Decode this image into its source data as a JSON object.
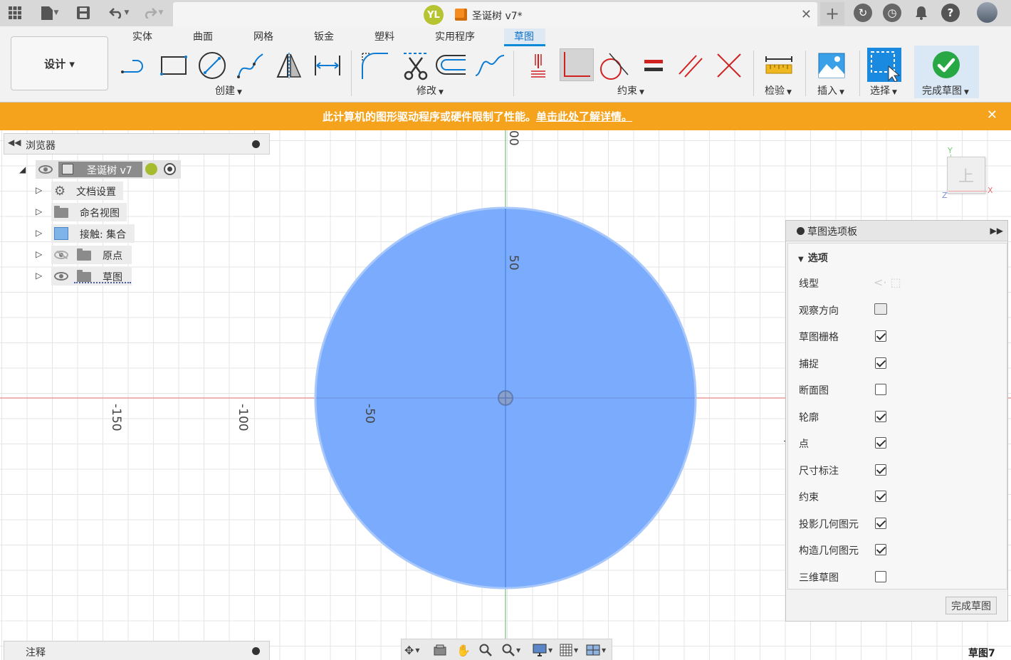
{
  "document": {
    "title": "圣诞树 v7*",
    "user_initials": "YL"
  },
  "ribbon": {
    "tabs": [
      "实体",
      "曲面",
      "网格",
      "钣金",
      "塑料",
      "实用程序",
      "草图"
    ],
    "active_tab": "草图",
    "design_button": "设计 ▾",
    "groups": {
      "create": "创建",
      "modify": "修改",
      "constrain": "约束",
      "inspect": "检验",
      "insert": "插入",
      "select": "选择",
      "finish": "完成草图"
    }
  },
  "warning": {
    "text": "此计算机的图形驱动程序或硬件限制了性能。",
    "link": "单击此处了解详情。"
  },
  "browser": {
    "title": "浏览器",
    "root": "圣诞树 v7",
    "items": [
      {
        "label": "文档设置",
        "icon": "gear-icon"
      },
      {
        "label": "命名视图",
        "icon": "folder-icon"
      },
      {
        "label": "接触: 集合",
        "icon": "contact-icon"
      },
      {
        "label": "原点",
        "icon": "folder-icon"
      },
      {
        "label": "草图",
        "icon": "folder-icon"
      }
    ]
  },
  "canvas": {
    "axis_labels": {
      "top_partial": "00",
      "y50": "50",
      "xm50": "-50",
      "xm100": "-100",
      "xm150": "-150"
    },
    "circle_color": "#7aabfc",
    "x_axis_color": "#e89b9b",
    "y_axis_color": "#8ed08e"
  },
  "viewcube": {
    "face": "上",
    "x": "X",
    "y": "Y",
    "z": "Z"
  },
  "palette": {
    "title": "草图选项板",
    "section": "选项",
    "options": [
      {
        "label": "线型",
        "type": "icons"
      },
      {
        "label": "观察方向",
        "type": "icon"
      },
      {
        "label": "草图栅格",
        "checked": true
      },
      {
        "label": "捕捉",
        "checked": true
      },
      {
        "label": "断面图",
        "checked": false
      },
      {
        "label": "轮廓",
        "checked": true
      },
      {
        "label": "点",
        "checked": true
      },
      {
        "label": "尺寸标注",
        "checked": true
      },
      {
        "label": "约束",
        "checked": true
      },
      {
        "label": "投影几何图元",
        "checked": true
      },
      {
        "label": "构造几何图元",
        "checked": true
      },
      {
        "label": "三维草图",
        "checked": false
      }
    ],
    "finish_button": "完成草图"
  },
  "notes": {
    "title": "注释"
  },
  "status": {
    "sketch_name": "草图7"
  }
}
